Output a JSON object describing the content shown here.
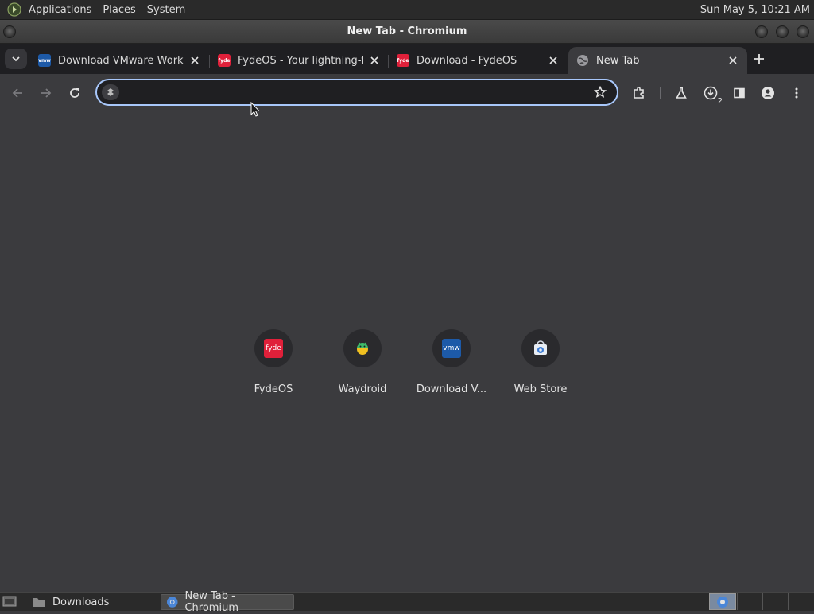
{
  "panel": {
    "menus": [
      "Applications",
      "Places",
      "System"
    ],
    "clock": "Sun May  5, 10:21 AM"
  },
  "window": {
    "title": "New Tab - Chromium"
  },
  "tabs": [
    {
      "title": "Download VMware Workstation",
      "favicon": "vmw",
      "favicon_color": "#1d5aa8",
      "active": false
    },
    {
      "title": "FydeOS - Your lightning-fast",
      "favicon": "fyde",
      "favicon_color": "#e0203a",
      "active": false
    },
    {
      "title": "Download - FydeOS",
      "favicon": "fyde",
      "favicon_color": "#e0203a",
      "active": false
    },
    {
      "title": "New Tab",
      "favicon": "globe-icon",
      "active": true
    }
  ],
  "toolbar": {
    "omnibox_value": "",
    "downloads_count": "2"
  },
  "shortcuts": [
    {
      "label": "FydeOS",
      "icon": "fyde",
      "color": "#e0203a"
    },
    {
      "label": "Waydroid",
      "icon": "waydroid-icon"
    },
    {
      "label": "Download V...",
      "icon": "vmw",
      "color": "#1d5aa8"
    },
    {
      "label": "Web Store",
      "icon": "web-store-icon"
    }
  ],
  "taskbar": {
    "items": [
      {
        "label": "Downloads",
        "icon": "folder-icon",
        "active": false
      },
      {
        "label": "New Tab - Chromium",
        "icon": "chromium-icon",
        "active": true
      }
    ]
  },
  "colors": {
    "accent": "#a8c7fa",
    "content_bg": "#3b3b3e",
    "tabstrip_bg": "#1f1f22"
  }
}
